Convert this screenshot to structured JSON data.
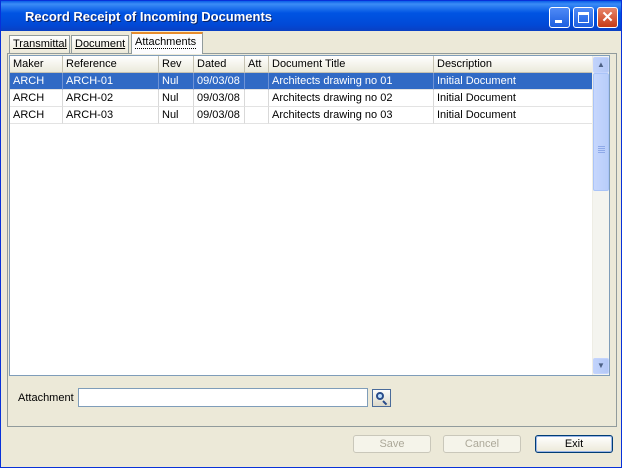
{
  "window": {
    "title": "Record Receipt of Incoming Documents"
  },
  "tabs": [
    {
      "label": "Transmittal",
      "active": false
    },
    {
      "label": "Document",
      "active": false
    },
    {
      "label": "Attachments",
      "active": true
    }
  ],
  "grid": {
    "columns": [
      "Maker",
      "Reference",
      "Rev",
      "Dated",
      "Att",
      "Document Title",
      "Description"
    ],
    "rows": [
      {
        "maker": "ARCH",
        "reference": "ARCH-01",
        "rev": "Nul",
        "dated": "09/03/08",
        "att": "",
        "title": "Architects drawing no 01",
        "description": "Initial Document",
        "selected": true
      },
      {
        "maker": "ARCH",
        "reference": "ARCH-02",
        "rev": "Nul",
        "dated": "09/03/08",
        "att": "",
        "title": "Architects drawing no 02",
        "description": "Initial Document",
        "selected": false
      },
      {
        "maker": "ARCH",
        "reference": "ARCH-03",
        "rev": "Nul",
        "dated": "09/03/08",
        "att": "",
        "title": "Architects drawing no 03",
        "description": "Initial Document",
        "selected": false
      }
    ]
  },
  "attachment": {
    "label": "Attachment",
    "value": ""
  },
  "buttons": {
    "save": {
      "label": "Save",
      "enabled": false
    },
    "cancel": {
      "label": "Cancel",
      "enabled": false
    },
    "exit": {
      "label": "Exit",
      "enabled": true
    }
  },
  "icons": {
    "minimize": "minimize-icon",
    "maximize": "maximize-icon",
    "close": "close-icon",
    "browse": "magnifier-icon",
    "scroll_up": "chevron-up-icon",
    "scroll_down": "chevron-down-icon"
  },
  "colors": {
    "titlebar": "#0054e3",
    "selection": "#316ac5",
    "active_tab_accent": "#e68b2c"
  }
}
